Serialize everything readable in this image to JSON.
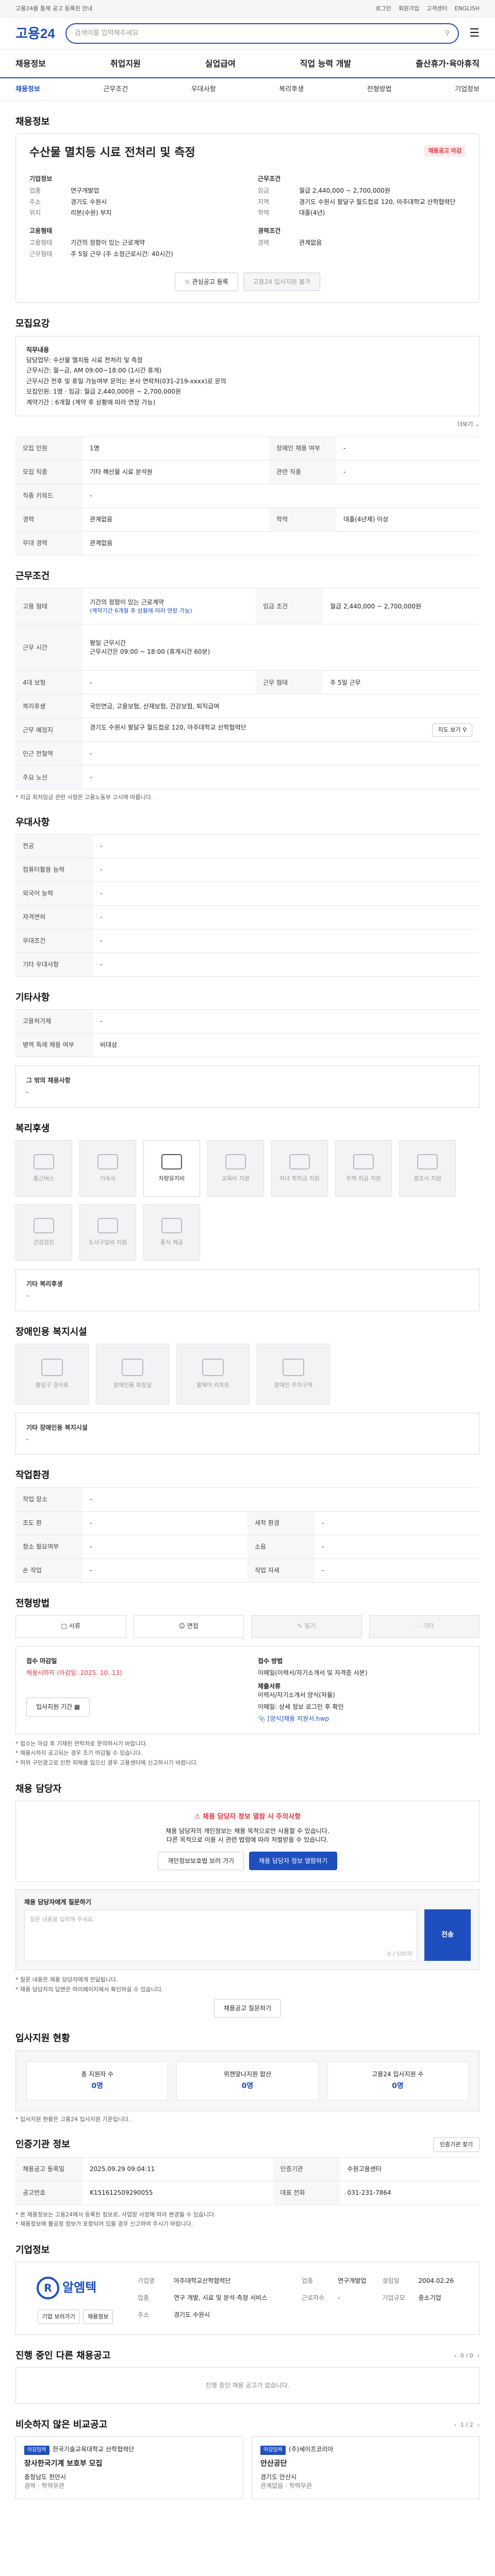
{
  "topbar": {
    "notice": "고용24를 통해 공고 등록된 안내",
    "links": [
      "로그인",
      "회원가입",
      "고객센터",
      "ENGLISH"
    ]
  },
  "header": {
    "logo": "고용24",
    "search_placeholder": "검색어를 입력해주세요"
  },
  "gnb": [
    "채용정보",
    "취업지원",
    "실업급여",
    "직업 능력 개발",
    "출산휴가·육아휴직"
  ],
  "lnb": {
    "items": [
      "채용정보",
      "근무조건",
      "우대사항",
      "복리후생",
      "전형방법",
      "기업정보"
    ],
    "active": 0
  },
  "job": {
    "section_title": "채용정보",
    "title": "수산물 멸치등 시료 전처리 및 측정",
    "badge": "채용공고 마감",
    "company_label": "기업정보",
    "company_rows": [
      {
        "k": "업종",
        "v": "연구개발업"
      },
      {
        "k": "주소",
        "v": "경기도 수원시"
      },
      {
        "k": "위치",
        "v": "리본(수원) 부지"
      }
    ],
    "cond_label": "근무조건",
    "cond_rows": [
      {
        "k": "임금",
        "v": "월급 2,440,000 ~ 2,700,000원"
      },
      {
        "k": "지역",
        "v": "경기도 수원시 팔달구 월드컵로 120, 아주대학교 산학협력단"
      },
      {
        "k": "학력",
        "v": "대졸(4년)"
      }
    ],
    "etc_label": "고용형태",
    "etc_rows": [
      {
        "k": "고용형태",
        "v": "기간의 정함이 있는 근로계약"
      },
      {
        "k": "근무형태",
        "v": "주 5일 근무 (주 소정근로시간: 40시간)"
      }
    ],
    "career_label": "경력조건",
    "career_rows": [
      {
        "k": "경력",
        "v": "관계없음"
      }
    ],
    "btn_interest": "관심공고 등록",
    "btn_apply": "고용24 입사지원 불가"
  },
  "summary": {
    "title": "모집요강",
    "lines": [
      "직무내용",
      "담당업무: 수산물 멸치등 시료 전처리 및 측정",
      "근무시간: 월~금, AM 09:00~18:00 (1시간 휴게)",
      "근무시간 전후 및 휴일 가능여부 문의는 본사 연락처(031-219-xxxx)로 문의",
      "모집인원: 1명 · 임금: 월급 2,440,000원 ~ 2,700,000원",
      "계약기간 : 6개월 (계약 후 상황에 따라 연장 가능)"
    ],
    "more": "더보기"
  },
  "recruit_table": {
    "rows": [
      [
        {
          "k": "모집 인원",
          "v": "1명"
        },
        {
          "k": "장애인 채용 여부",
          "v": "-"
        }
      ],
      [
        {
          "k": "모집 직종",
          "v": "기타 해산물 시료 분석원"
        },
        {
          "k": "관련 직종",
          "v": "-"
        }
      ],
      [
        {
          "k": "직종 키워드",
          "v": "-"
        },
        {
          "k": "",
          "v": ""
        }
      ],
      [
        {
          "k": "경력",
          "v": "관계없음"
        },
        {
          "k": "학력",
          "v": "대졸(4년제) 이상"
        }
      ],
      [
        {
          "k": "우대 경력",
          "v": "관계없음"
        },
        {
          "k": "",
          "v": ""
        }
      ]
    ]
  },
  "conditions": {
    "title": "근무조건",
    "employ_k": "고용 형태",
    "employ_v": "기간의 정함이 있는 근로계약",
    "employ_sub": "(계약기간 6개월 후 상황에 따라 연장 가능)",
    "wage_k": "임금 조건",
    "wage_v": "월급 2,440,000 ~ 2,700,000원",
    "hours_k": "근무 시간",
    "hours_v1": "평일 근무시간",
    "hours_v2": "근무시간은 09:00 ~ 18:00 (휴게시간 60분)",
    "insurance_k": "4대 보험",
    "insurance_v": "-",
    "workday_k": "근무 형태",
    "workday_v": "주 5일 근무",
    "welfare_k": "복리후생",
    "welfare_v": "국민연금, 고용보험, 산재보험, 건강보험, 퇴직급여",
    "place_k": "근무 예정지",
    "place_v": "경기도 수원시 팔달구 월드컵로 120, 아주대학교 산학협력단",
    "station_k": "인근 전철역",
    "station_v": "-",
    "commute_k": "주요 노선",
    "commute_v": "-",
    "map_btn": "지도 보기",
    "note": "* 지급 최저임금 관련 사항은 고용노동부 고시에 따릅니다."
  },
  "preferred": {
    "title": "우대사항",
    "rows": [
      {
        "k": "전공",
        "v": "-"
      },
      {
        "k": "컴퓨터활용 능력",
        "v": "-"
      },
      {
        "k": "외국어 능력",
        "v": "-"
      },
      {
        "k": "자격면허",
        "v": "-"
      },
      {
        "k": "우대조건",
        "v": "-"
      },
      {
        "k": "기타 우대사항",
        "v": "-"
      }
    ]
  },
  "other": {
    "title": "기타사항",
    "rows": [
      {
        "k": "고용허가제",
        "v": "-"
      },
      {
        "k": "병역 특례 채용 여부",
        "v": "비대상"
      }
    ],
    "extra_title": "그 밖의 채용사항",
    "extra": "-"
  },
  "benefits": {
    "title": "복리후생",
    "items": [
      {
        "label": "통근버스",
        "on": false
      },
      {
        "label": "기숙사",
        "on": false
      },
      {
        "label": "차량유지비",
        "on": true
      },
      {
        "label": "교육비 지원",
        "on": false
      },
      {
        "label": "자녀 학자금 지원",
        "on": false
      },
      {
        "label": "주택 자금 지원",
        "on": false
      },
      {
        "label": "경조사 지원",
        "on": false
      },
      {
        "label": "건강검진",
        "on": false
      },
      {
        "label": "도서구입비 지원",
        "on": false
      },
      {
        "label": "중식 제공",
        "on": false
      }
    ],
    "other_title": "기타 복리후생",
    "other_value": "-"
  },
  "disability": {
    "title": "장애인용 복지시설",
    "items": [
      "출입구 경사로",
      "장애인용 화장실",
      "휠체어 리프트",
      "장애인 주차구역"
    ],
    "other_title": "기타 장애인용 복지시설",
    "other_value": "-"
  },
  "workenv": {
    "title": "작업환경",
    "rows": [
      [
        {
          "k": "작업 장소",
          "v": "-"
        },
        {
          "k": "",
          "v": ""
        }
      ],
      [
        {
          "k": "조도 환",
          "v": "-"
        },
        {
          "k": "세척 환경",
          "v": "-"
        }
      ],
      [
        {
          "k": "청소 필요여부",
          "v": "-"
        },
        {
          "k": "소음",
          "v": "-"
        }
      ],
      [
        {
          "k": "손 작업",
          "v": "-"
        },
        {
          "k": "작업 자세",
          "v": "-"
        }
      ]
    ]
  },
  "selection": {
    "title": "전형방법",
    "steps": [
      {
        "label": "서류",
        "on": true
      },
      {
        "label": "면접",
        "on": true
      },
      {
        "label": "필기",
        "on": false
      },
      {
        "label": "기타",
        "on": false
      }
    ],
    "deadline_k": "접수 마감일",
    "deadline_v": "채용시까지 (마감일: 2025. 10. 13)",
    "method_k": "접수 방법",
    "method_v": "이메일(이력서/자기소개서 및 자격증 사본)",
    "docs_k": "제출서류",
    "docs_v": "이력서/자기소개서 양식(자율)",
    "email": "이메일: 상세 정보 로그인 후 확인",
    "attach": "[양식]채용 지원서.hwp",
    "apply_btn": "입사지원 기간",
    "warnings": [
      "* 접수는 마감 후 기재된 연락처로 문의하시기 바랍니다.",
      "* 채용시까지 공고되는 경우 조기 마감될 수 있습니다.",
      "* 허위 구인광고로 인한 피해를 입으신 경우 고용센터에 신고하시기 바랍니다."
    ]
  },
  "contact": {
    "title": "채용 담당자",
    "alert": "채용 담당자 정보 열람 시 주의사항",
    "desc1": "채용 담당자의 개인정보는 채용 목적으로만 사용할 수 있습니다.",
    "desc2": "다른 목적으로 이용 시 관련 법령에 따라 처벌받을 수 있습니다.",
    "btn1": "개인정보보호법 보러 가기",
    "btn2": "채용 담당자 정보 열람하기",
    "q_title": "채용 담당자에게 질문하기",
    "q_hint": "질문 내용을 입력해 주세요.",
    "q_count": "0 / 500자",
    "q_send": "전송",
    "q_notes": [
      "* 질문 내용은 채용 담당자에게 전달됩니다.",
      "* 채용 담당자의 답변은 마이페이지에서 확인하실 수 있습니다."
    ],
    "q_btn": "채용공고 질문하기"
  },
  "stats": {
    "title": "입사지원 현황",
    "items": [
      {
        "label": "총 지원자 수",
        "value": "0명"
      },
      {
        "label": "위캔맞나지원 합산",
        "value": "0명"
      },
      {
        "label": "고용24 입사지원 수",
        "value": "0명"
      }
    ],
    "note": "* 입사지원 현황은 고용24 입사지원 기준입니다."
  },
  "agency": {
    "title": "인증기관 정보",
    "btn": "인증기관 찾기",
    "rows": [
      [
        {
          "k": "채용공고 등록일",
          "v": "2025.09.29 09:04:11"
        },
        {
          "k": "인증기관",
          "v": "수원고용센터"
        }
      ],
      [
        {
          "k": "공고번호",
          "v": "K151612509290055"
        },
        {
          "k": "대표 전화",
          "v": "031-231-7864"
        }
      ]
    ],
    "notes": [
      "* 본 채용정보는 고용24에서 등록된 정보로, 사업장 사정에 따라 변경될 수 있습니다.",
      "* 채용정보에 불공정 정보가 포함되어 있을 경우 신고하여 주시기 바랍니다."
    ]
  },
  "company": {
    "title": "기업정보",
    "logo_text": "알엠텍",
    "logo_mark": "R",
    "btn1": "기업 보러가기",
    "btn2": "채용정보",
    "rows": [
      [
        {
          "k": "기업명",
          "v": "아주대학교산학협력단"
        },
        {
          "k": "업종",
          "v": "연구개발업"
        },
        {
          "k": "설립일",
          "v": "2004.02.26"
        }
      ],
      [
        {
          "k": "업종",
          "v": "연구 개발, 시료 및 분석·측정 서비스"
        },
        {
          "k": "근로자수",
          "v": "-"
        },
        {
          "k": "기업규모",
          "v": "중소기업"
        }
      ],
      [
        {
          "k": "주소",
          "v": "경기도 수원시"
        },
        {
          "k": "",
          "v": ""
        },
        {
          "k": "",
          "v": ""
        }
      ]
    ]
  },
  "ongoing": {
    "title": "진행 중인 다른 채용공고",
    "empty": "진행 중인 채용 공고가 없습니다.",
    "pager": "0 / 0"
  },
  "similar": {
    "title": "비슷하지 않은 비교공고",
    "pager": "1 / 2",
    "cards": [
      {
        "tag": "마감임박",
        "company": "한국기술교육대학교 산학협력단",
        "title": "장사한국기계 보호부 모집",
        "loc": "충청남도 천안시",
        "detail": "경력 · 학력무관"
      },
      {
        "tag": "마감임박",
        "company": "(주)세이프코리아",
        "title": "안산공단",
        "loc": "경기도 안산시",
        "detail": "관계없음 · 학력무관"
      }
    ]
  }
}
